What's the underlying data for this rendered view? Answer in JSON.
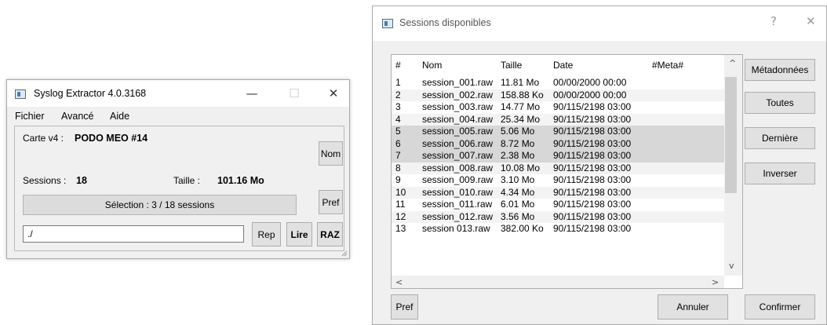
{
  "main_window": {
    "title": "Syslog Extractor 4.0.3168",
    "controls": {
      "minimize": "—",
      "maximize": "☐",
      "close": "✕"
    },
    "menu": [
      "Fichier",
      "Avancé",
      "Aide"
    ],
    "carte_label": "Carte v4 :",
    "carte_value": "PODO MEO #14",
    "sessions_label": "Sessions :",
    "sessions_value": "18",
    "taille_label": "Taille :",
    "taille_value": "101.16 Mo",
    "selection_text": "Sélection : 3 / 18 sessions",
    "path_value": "./",
    "buttons": {
      "nom": "Nom",
      "pref": "Pref",
      "rep": "Rep",
      "lire": "Lire",
      "raz": "RAZ"
    }
  },
  "sessions_dialog": {
    "title": "Sessions disponibles",
    "controls": {
      "help": "?",
      "close": "✕"
    },
    "columns": [
      "#",
      "Nom",
      "Taille",
      "Date",
      "#Meta#"
    ],
    "rows": [
      {
        "num": "1",
        "nom": "session_001.raw",
        "taille": "11.81 Mo",
        "date": "00/00/2000 00:00",
        "selected": false
      },
      {
        "num": "2",
        "nom": "session_002.raw",
        "taille": "158.88 Ko",
        "date": "00/00/2000 00:00",
        "selected": false
      },
      {
        "num": "3",
        "nom": "session_003.raw",
        "taille": "14.77 Mo",
        "date": "90/115/2198 03:00",
        "selected": false
      },
      {
        "num": "4",
        "nom": "session_004.raw",
        "taille": "25.34 Mo",
        "date": "90/115/2198 03:00",
        "selected": false
      },
      {
        "num": "5",
        "nom": "session_005.raw",
        "taille": "5.06 Mo",
        "date": "90/115/2198 03:00",
        "selected": true
      },
      {
        "num": "6",
        "nom": "session_006.raw",
        "taille": "8.72 Mo",
        "date": "90/115/2198 03:00",
        "selected": true
      },
      {
        "num": "7",
        "nom": "session_007.raw",
        "taille": "2.38 Mo",
        "date": "90/115/2198 03:00",
        "selected": true
      },
      {
        "num": "8",
        "nom": "session_008.raw",
        "taille": "10.08 Mo",
        "date": "90/115/2198 03:00",
        "selected": false
      },
      {
        "num": "9",
        "nom": "session_009.raw",
        "taille": "3.10 Mo",
        "date": "90/115/2198 03:00",
        "selected": false
      },
      {
        "num": "10",
        "nom": "session_010.raw",
        "taille": "4.34 Mo",
        "date": "90/115/2198 03:00",
        "selected": false
      },
      {
        "num": "11",
        "nom": "session_011.raw",
        "taille": "6.01 Mo",
        "date": "90/115/2198 03:00",
        "selected": false
      },
      {
        "num": "12",
        "nom": "session_012.raw",
        "taille": "3.56 Mo",
        "date": "90/115/2198 03:00",
        "selected": false
      },
      {
        "num": "13",
        "nom": "session 013.raw",
        "taille": "382.00 Ko",
        "date": "90/115/2198 03:00",
        "selected": false
      }
    ],
    "scroll_arrows": {
      "up": "^",
      "down": "v",
      "left": "<",
      "right": ">"
    },
    "side_buttons": [
      "Métadonnées",
      "Toutes",
      "Dernière",
      "Inverser"
    ],
    "bottom_buttons": {
      "pref": "Pref",
      "cancel": "Annuler",
      "confirm": "Confirmer"
    }
  }
}
